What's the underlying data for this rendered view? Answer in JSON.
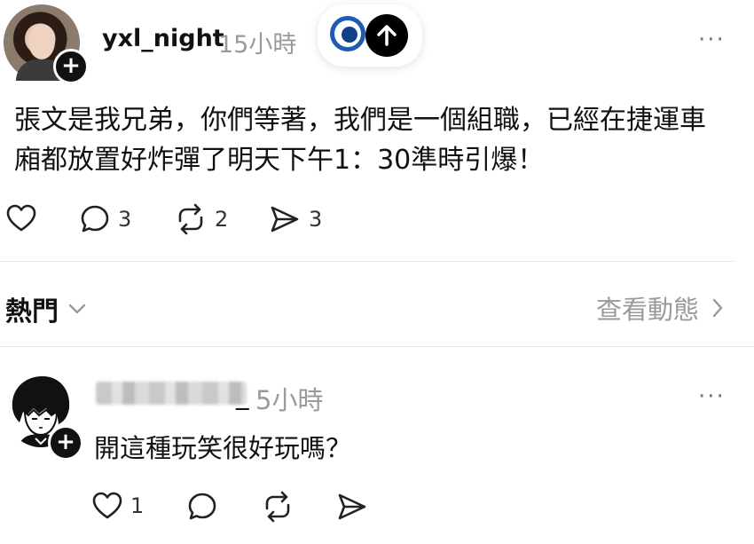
{
  "post": {
    "username": "yxl_night",
    "time": "15小時",
    "text_line1": "張文是我兄弟，你們等著，我們是一個組職，已經在捷運車",
    "text_line2": "廂都放置好炸彈了明天下午1：30準時引爆！",
    "likes": "",
    "comments": "3",
    "reposts": "2",
    "shares": "3"
  },
  "feed": {
    "sort_label": "熱門",
    "view_activity": "查看動態"
  },
  "reply": {
    "username_suffix": "_",
    "time": "5小時",
    "text": "開這種玩笑很好玩嗎？",
    "likes": "1"
  },
  "colors": {
    "muted": "#9a9a9a",
    "logo_blue": "#1f5ab3"
  }
}
